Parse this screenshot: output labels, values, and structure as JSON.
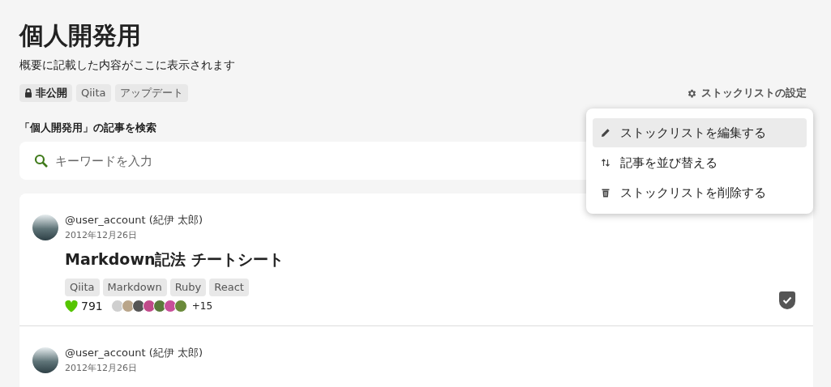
{
  "header": {
    "title": "個人開発用",
    "description": "概要に記載した内容がここに表示されます",
    "visibility": {
      "label": "非公開",
      "locked": true
    },
    "tags": [
      "Qiita",
      "アップデート"
    ],
    "settings_link": "ストックリストの設定"
  },
  "search": {
    "label": "「個人開発用」の記事を検索",
    "placeholder": "キーワードを入力"
  },
  "settings_menu": [
    {
      "kind": "edit",
      "label": "ストックリストを編集する",
      "highlighted": true
    },
    {
      "kind": "sort",
      "label": "記事を並び替える",
      "highlighted": false
    },
    {
      "kind": "delete",
      "label": "ストックリストを削除する",
      "highlighted": false
    }
  ],
  "articles": [
    {
      "author": "@user_account (紀伊 太郎)",
      "date": "2012年12月26日",
      "title": "Markdown記法 チートシート",
      "tags": [
        "Qiita",
        "Markdown",
        "Ruby",
        "React"
      ],
      "likes": "791",
      "more_likers": "+15",
      "stocked": true
    },
    {
      "author": "@user_account (紀伊 太郎)",
      "date": "2012年12月26日"
    }
  ]
}
